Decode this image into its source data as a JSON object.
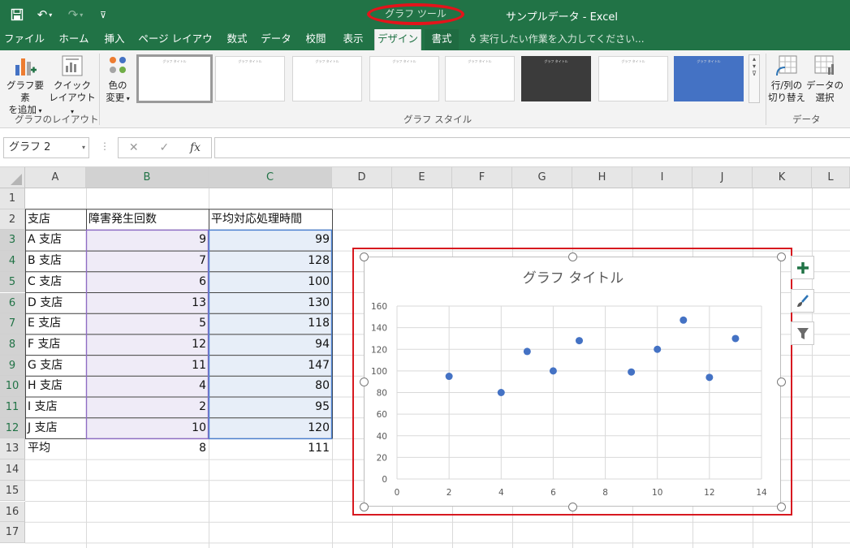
{
  "window": {
    "contextual_tools": "グラフ ツール",
    "title": "サンプルデータ - Excel"
  },
  "tabs": [
    {
      "label": "ファイル"
    },
    {
      "label": "ホーム"
    },
    {
      "label": "挿入"
    },
    {
      "label": "ページ レイアウト"
    },
    {
      "label": "数式"
    },
    {
      "label": "データ"
    },
    {
      "label": "校閲"
    },
    {
      "label": "表示"
    },
    {
      "label": "デザイン"
    },
    {
      "label": "書式"
    }
  ],
  "tell_me": "実行したい作業を入力してください...",
  "ribbon": {
    "add_element_l1": "グラフ要素",
    "add_element_l2": "を追加",
    "quick_layout_l1": "クイック",
    "quick_layout_l2": "レイアウト",
    "change_color_l1": "色の",
    "change_color_l2": "変更",
    "group_layout": "グラフのレイアウト",
    "group_styles": "グラフ スタイル",
    "switch_l1": "行/列の",
    "switch_l2": "切り替え",
    "select_data_l1": "データの",
    "select_data_l2": "選択",
    "group_data": "データ",
    "thumb_title": "グラフ タイトル"
  },
  "formula_bar": {
    "name_box": "グラフ 2",
    "fx": "fx",
    "cancel": "✕",
    "enter": "✓",
    "value": ""
  },
  "columns": [
    "A",
    "B",
    "C",
    "D",
    "E",
    "F",
    "G",
    "H",
    "I",
    "J",
    "K",
    "L"
  ],
  "rows": [
    "1",
    "2",
    "3",
    "4",
    "5",
    "6",
    "7",
    "8",
    "9",
    "10",
    "11",
    "12",
    "13",
    "14",
    "15",
    "16",
    "17"
  ],
  "table": {
    "header": [
      "支店",
      "障害発生回数",
      "平均対応処理時間"
    ],
    "rows": [
      [
        "A 支店",
        "9",
        "99"
      ],
      [
        "B 支店",
        "7",
        "128"
      ],
      [
        "C 支店",
        "6",
        "100"
      ],
      [
        "D 支店",
        "13",
        "130"
      ],
      [
        "E 支店",
        "5",
        "118"
      ],
      [
        "F 支店",
        "12",
        "94"
      ],
      [
        "G 支店",
        "11",
        "147"
      ],
      [
        "H 支店",
        "4",
        "80"
      ],
      [
        "I 支店",
        "2",
        "95"
      ],
      [
        "J 支店",
        "10",
        "120"
      ]
    ],
    "footer": [
      "平均",
      "8",
      "111"
    ]
  },
  "chart_data": {
    "type": "scatter",
    "title": "グラフ タイトル",
    "xlabel": "",
    "ylabel": "",
    "xlim": [
      0,
      14
    ],
    "ylim": [
      0,
      160
    ],
    "xticks": [
      "0",
      "2",
      "4",
      "6",
      "8",
      "10",
      "12",
      "14"
    ],
    "yticks": [
      "0",
      "20",
      "40",
      "60",
      "80",
      "100",
      "120",
      "140",
      "160"
    ],
    "grid": true,
    "legend": "none",
    "marker_color": "#4472c4",
    "series": [
      {
        "x": [
          9,
          7,
          6,
          13,
          5,
          12,
          11,
          4,
          2,
          10
        ],
        "y": [
          99,
          128,
          100,
          130,
          118,
          94,
          147,
          80,
          95,
          120
        ]
      }
    ]
  },
  "colors": {
    "excel_green": "#217346",
    "selection_red": "#d71920",
    "range_b": "#efebf7",
    "range_c": "#e7eef8"
  }
}
